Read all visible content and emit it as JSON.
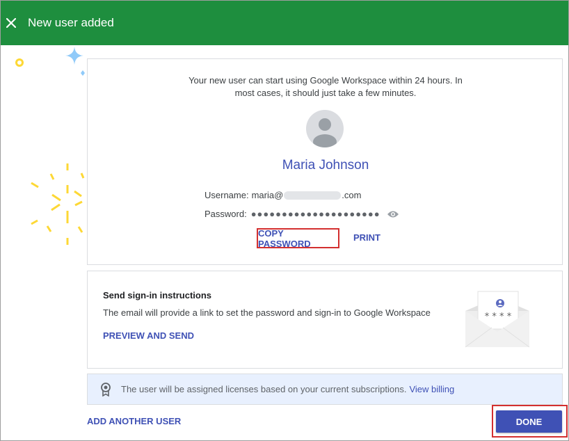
{
  "header": {
    "title": "New user added",
    "close_icon": "close-icon"
  },
  "user_card": {
    "intro": "Your new user can start using Google Workspace within 24 hours. In most cases, it should just take a few minutes.",
    "avatar_icon": "person-avatar-icon",
    "name": "Maria Johnson",
    "username_label": "Username:",
    "username_prefix": "maria@",
    "username_suffix": ".com",
    "password_label": "Password:",
    "password_mask": "●●●●●●●●●●●●●●●●●●●●●",
    "show_password_icon": "eye-icon",
    "copy_password_label": "COPY PASSWORD",
    "print_label": "PRINT"
  },
  "signin_card": {
    "title": "Send sign-in instructions",
    "description": "The email will provide a link to set the password and sign-in to Google Workspace",
    "preview_label": "PREVIEW AND SEND",
    "envelope_icon": "envelope-credentials-icon"
  },
  "license_banner": {
    "icon": "license-badge-icon",
    "text": "The user will be assigned licenses based on your current subscriptions.",
    "link": "View billing"
  },
  "footer": {
    "add_another_label": "ADD ANOTHER USER",
    "done_label": "DONE"
  },
  "colors": {
    "header_green": "#1e8e3e",
    "accent_blue": "#3f51b5",
    "highlight_red": "#d32f2f",
    "banner_bg": "#e8f0fe",
    "confetti_yellow": "#fdd835",
    "sparkle_blue": "#90caf9"
  }
}
